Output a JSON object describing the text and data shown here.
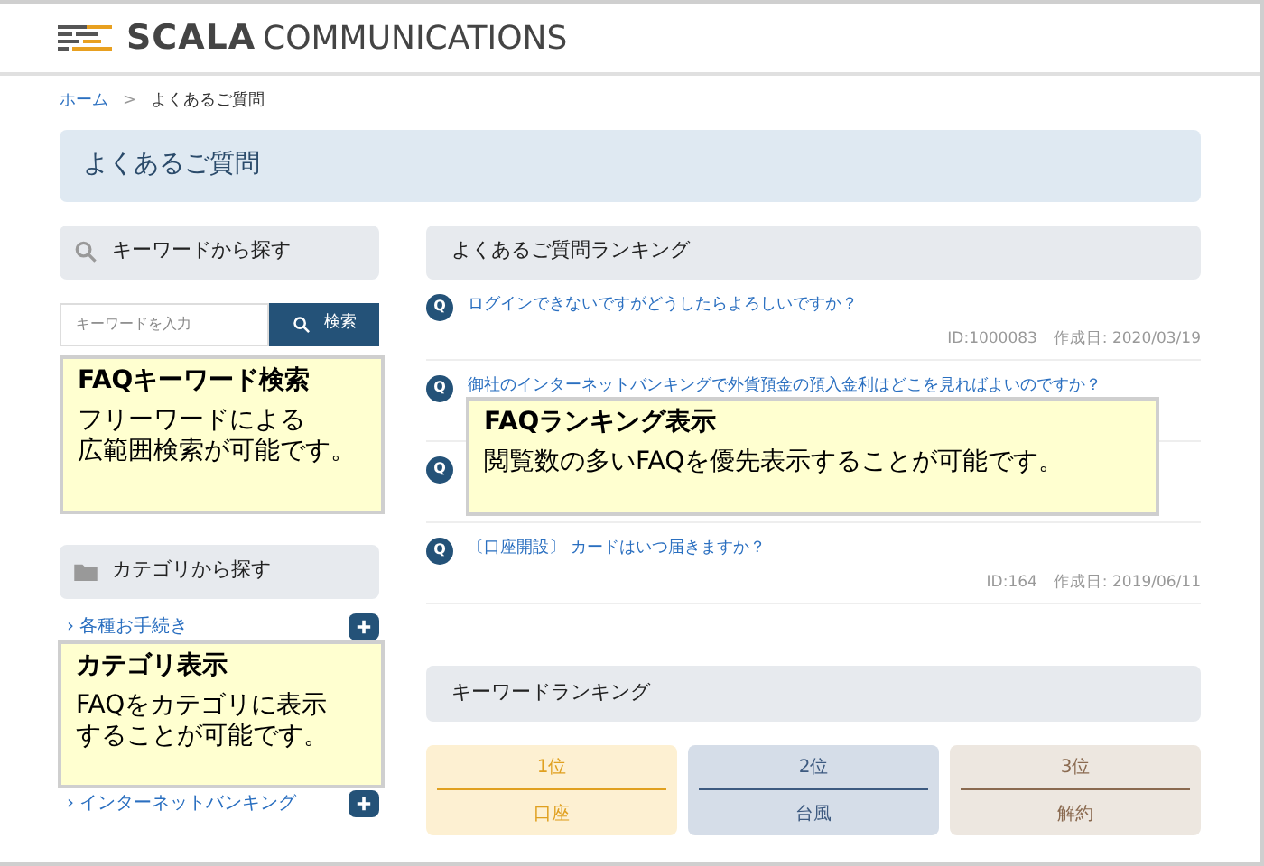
{
  "header": {
    "logo_text_bold": "SCALA",
    "logo_text": "COMMUNICATIONS"
  },
  "breadcrumb": [
    {
      "label": "ホーム",
      "kind": "link"
    },
    {
      "label": ">",
      "kind": "separator"
    },
    {
      "label": "よくあるご質問",
      "kind": "current"
    }
  ],
  "page_title": "よくあるご質問",
  "keyword_search": {
    "title": "キーワードから探す",
    "placeholder": "キーワードを入力",
    "button": "検索"
  },
  "categories": {
    "title": "カテゴリから探す",
    "items": [
      {
        "arrow": "›",
        "label": "各種お手続き"
      },
      {
        "arrow": "›",
        "label": "インターネットバンキング"
      }
    ]
  },
  "faq_ranking": {
    "title": "よくあるご質問ランキング",
    "items": [
      {
        "badge": "Q",
        "question": "ログインできないですがどうしたらよろしいですか？",
        "meta": "ID:1000083　作成日: 2020/03/19"
      },
      {
        "badge": "Q",
        "question": "御社のインターネットバンキングで外貨預金の預入金利はどこを見ればよいのですか？"
      },
      {
        "badge": "Q"
      },
      {
        "badge": "Q",
        "question": "〔口座開設〕 カードはいつ届きますか？",
        "meta": "ID:164　作成日: 2019/06/11"
      }
    ]
  },
  "keyword_ranking": {
    "title": "キーワードランキング",
    "items": [
      {
        "rank": "1位",
        "word": "口座",
        "color": "#e0a020"
      },
      {
        "rank": "2位",
        "word": "台風",
        "color": "#3d5a80"
      },
      {
        "rank": "3位",
        "word": "解約",
        "color": "#8a6a50"
      }
    ]
  },
  "callouts": [
    {
      "title": "FAQキーワード検索",
      "lines": [
        "フリーワードによる",
        "広範囲検索が可能です。"
      ]
    },
    {
      "title": "FAQランキング表示",
      "lines": [
        "閲覧数の多いFAQを優先表示することが可能です。"
      ]
    },
    {
      "title": "カテゴリ表示",
      "lines": [
        "FAQをカテゴリに表示",
        "することが可能です。"
      ]
    }
  ]
}
